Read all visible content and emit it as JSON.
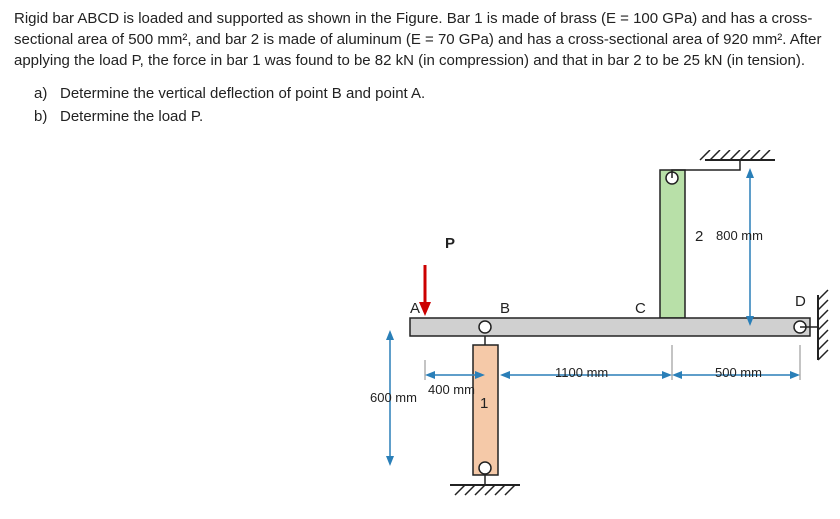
{
  "problem_text_parts": {
    "p1": "Rigid bar ABCD is loaded and supported as shown in the Figure. Bar 1 is made of brass (E = 100 GPa) and has a cross-sectional area of 500 mm², and bar 2 is made of aluminum (E = 70 GPa) and has a cross-sectional area of 920 mm². After applying the load P, the force in bar 1 was found to be 82 kN (in compression) and that in bar 2 to be 25 kN (in tension)."
  },
  "questions": {
    "a_letter": "a)",
    "a_text": "Determine the vertical deflection of point B and point A.",
    "b_letter": "b)",
    "b_text": "Determine the load P."
  },
  "labels": {
    "A": "A",
    "B": "B",
    "C": "C",
    "D": "D",
    "P": "P",
    "bar1": "1",
    "bar2": "2"
  },
  "dimensions": {
    "d_600": "600 mm",
    "d_400": "400 mm",
    "d_1100": "1100 mm",
    "d_500": "500 mm",
    "d_800": "800 mm"
  },
  "chart_data": {
    "type": "diagram",
    "bars": [
      {
        "name": "bar1",
        "material": "brass",
        "E_GPa": 100,
        "area_mm2": 500,
        "length_mm": 600,
        "force_kN": 82,
        "state": "compression"
      },
      {
        "name": "bar2",
        "material": "aluminum",
        "E_GPa": 70,
        "area_mm2": 920,
        "length_mm": 800,
        "force_kN": 25,
        "state": "tension"
      }
    ],
    "horizontal_spans_mm": {
      "A_to_B": 400,
      "B_to_C": 1100,
      "C_to_D": 500
    },
    "load": "P at A (downward)",
    "pin_support": "D"
  }
}
